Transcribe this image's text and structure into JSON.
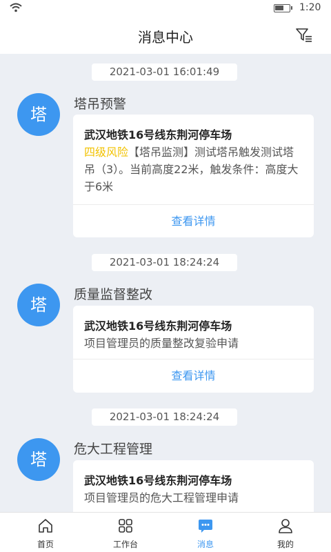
{
  "status_bar": {
    "time": "1:20",
    "battery_level": 0.6
  },
  "header": {
    "title": "消息中心",
    "filter_icon": "filter-icon"
  },
  "messages": [
    {
      "timestamp": "2021-03-01  16:01:49",
      "avatar_text": "塔",
      "type": "塔吊预警",
      "project": "武汉地铁16号线东荆河停车场",
      "risk_level": "四级风险",
      "content": "【塔吊监测】测试塔吊触发测试塔吊（3）。当前高度22米，触发条件：高度大于6米",
      "action": "查看详情"
    },
    {
      "timestamp": "2021-03-01  18:24:24",
      "avatar_text": "塔",
      "type": "质量监督整改",
      "project": "武汉地铁16号线东荆河停车场",
      "content": "项目管理员的质量整改复验申请",
      "action": "查看详情"
    },
    {
      "timestamp": "2021-03-01  18:24:24",
      "avatar_text": "塔",
      "type": "危大工程管理",
      "project": "武汉地铁16号线东荆河停车场",
      "content": "项目管理员的危大工程管理申请"
    }
  ],
  "tabs": [
    {
      "label": "首页",
      "icon": "home-icon"
    },
    {
      "label": "工作台",
      "icon": "grid-icon"
    },
    {
      "label": "消息",
      "icon": "message-icon",
      "active": true
    },
    {
      "label": "我的",
      "icon": "user-icon"
    }
  ],
  "colors": {
    "accent": "#3d97f0",
    "risk": "#f2c200",
    "background": "#eceff4"
  }
}
